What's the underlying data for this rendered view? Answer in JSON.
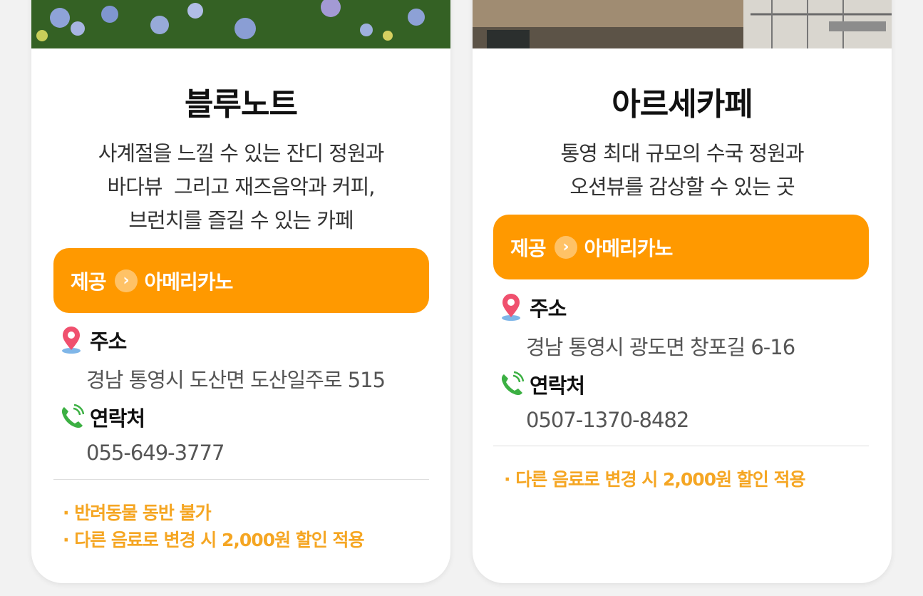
{
  "cards": [
    {
      "title": "블루노트",
      "description": [
        "사계절을 느낄 수 있는 잔디 정원과",
        "바다뷰  그리고 재즈음악과 커피,",
        "브런치를 즐길 수 있는 카페"
      ],
      "offer": {
        "label": "제공",
        "item": "아메리카노",
        "chevron": "›"
      },
      "address": {
        "label": "주소",
        "value": "경남 통영시 도산면 도산일주로 515"
      },
      "contact": {
        "label": "연락처",
        "value": "055-649-3777"
      },
      "notes": [
        "· 반려동물 동반 불가",
        "· 다른 음료로 변경 시 2,000원 할인 적용"
      ],
      "photo_icon": "hydrangea-garden-photo"
    },
    {
      "title": "아르세카페",
      "description": [
        "통영 최대 규모의 수국 정원과",
        "오션뷰를 감상할 수 있는 곳"
      ],
      "offer": {
        "label": "제공",
        "item": "아메리카노",
        "chevron": "›"
      },
      "address": {
        "label": "주소",
        "value": "경남 통영시 광도면 창포길 6-16"
      },
      "contact": {
        "label": "연락처",
        "value": "0507-1370-8482"
      },
      "notes": [
        "· 다른 음료로 변경 시 2,000원 할인 적용"
      ],
      "photo_icon": "cafe-interior-photo"
    }
  ],
  "colors": {
    "accent": "#ff9900",
    "note": "#f5a623",
    "pin": "#f0506e",
    "phone": "#3cb043"
  }
}
